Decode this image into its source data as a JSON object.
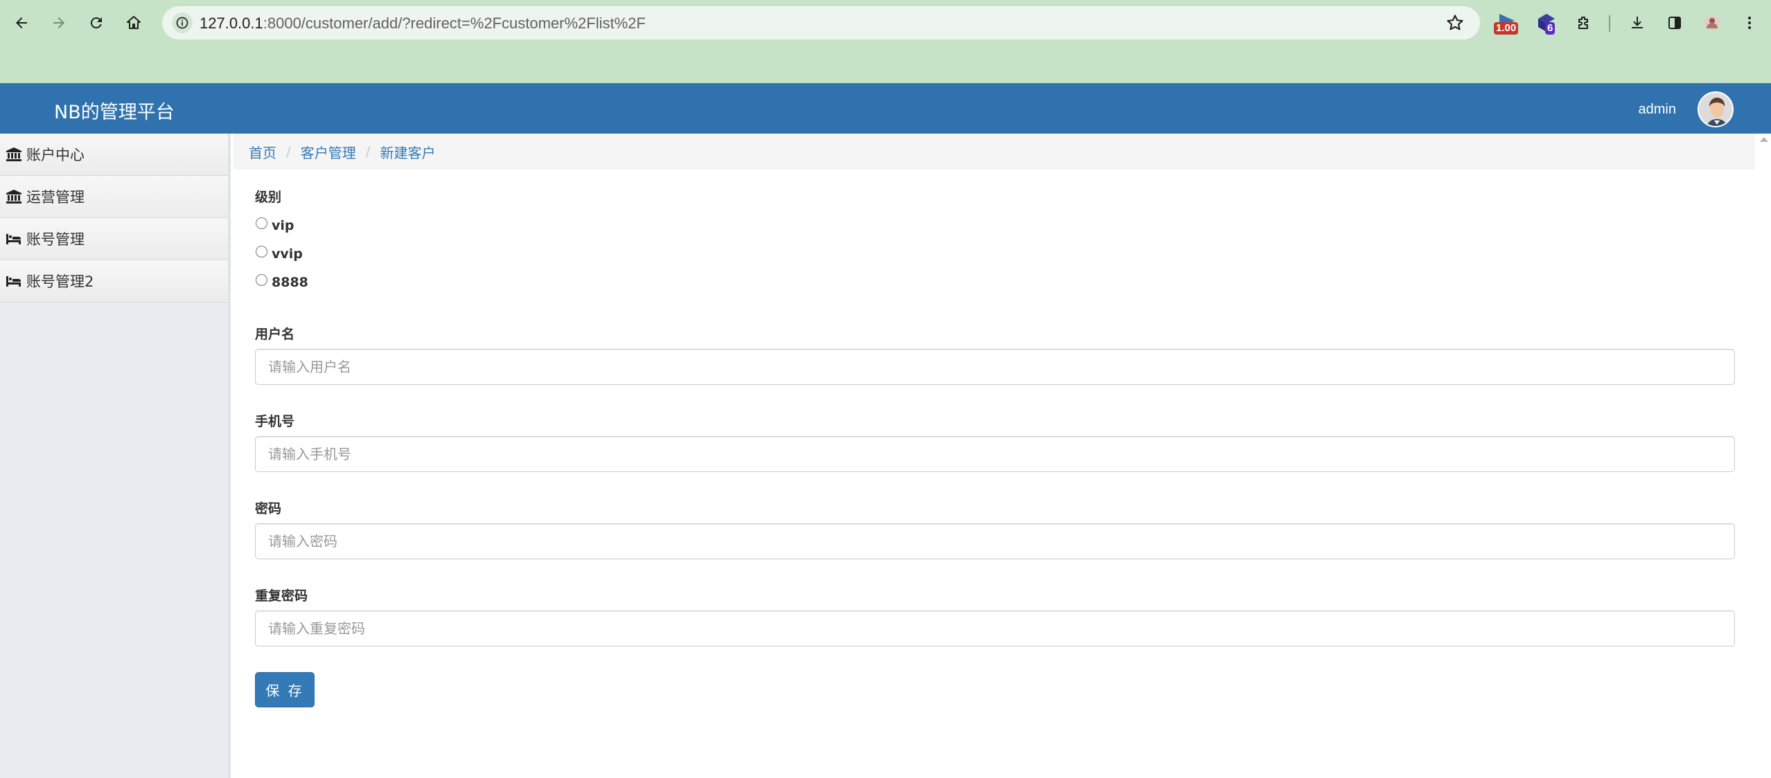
{
  "browser": {
    "url_host": "127.0.0.1",
    "url_path": ":8000/customer/add/?redirect=%2Fcustomer%2Flist%2F",
    "extensions": [
      {
        "icon": "speed-extension-icon",
        "badge": "1.00",
        "badge_color": "#c0392b"
      },
      {
        "icon": "extension-cube-icon",
        "badge": "6",
        "badge_color": "#5b2dbd"
      }
    ]
  },
  "header": {
    "brand": "NB的管理平台",
    "user": "admin",
    "bar_color": "#2f72ae"
  },
  "sidebar": {
    "items": [
      {
        "label": "账户中心",
        "icon": "bank-icon"
      },
      {
        "label": "运营管理",
        "icon": "bank-icon"
      },
      {
        "label": "账号管理",
        "icon": "bed-icon"
      },
      {
        "label": "账号管理2",
        "icon": "bed-icon"
      }
    ]
  },
  "breadcrumb": [
    "首页",
    "客户管理",
    "新建客户"
  ],
  "form": {
    "level_label": "级别",
    "level_options": [
      "vip",
      "vvip",
      "8888"
    ],
    "username_label": "用户名",
    "username_placeholder": "请输入用户名",
    "phone_label": "手机号",
    "phone_placeholder": "请输入手机号",
    "password_label": "密码",
    "password_placeholder": "请输入密码",
    "confirm_label": "重复密码",
    "confirm_placeholder": "请输入重复密码",
    "save_label": "保 存"
  }
}
